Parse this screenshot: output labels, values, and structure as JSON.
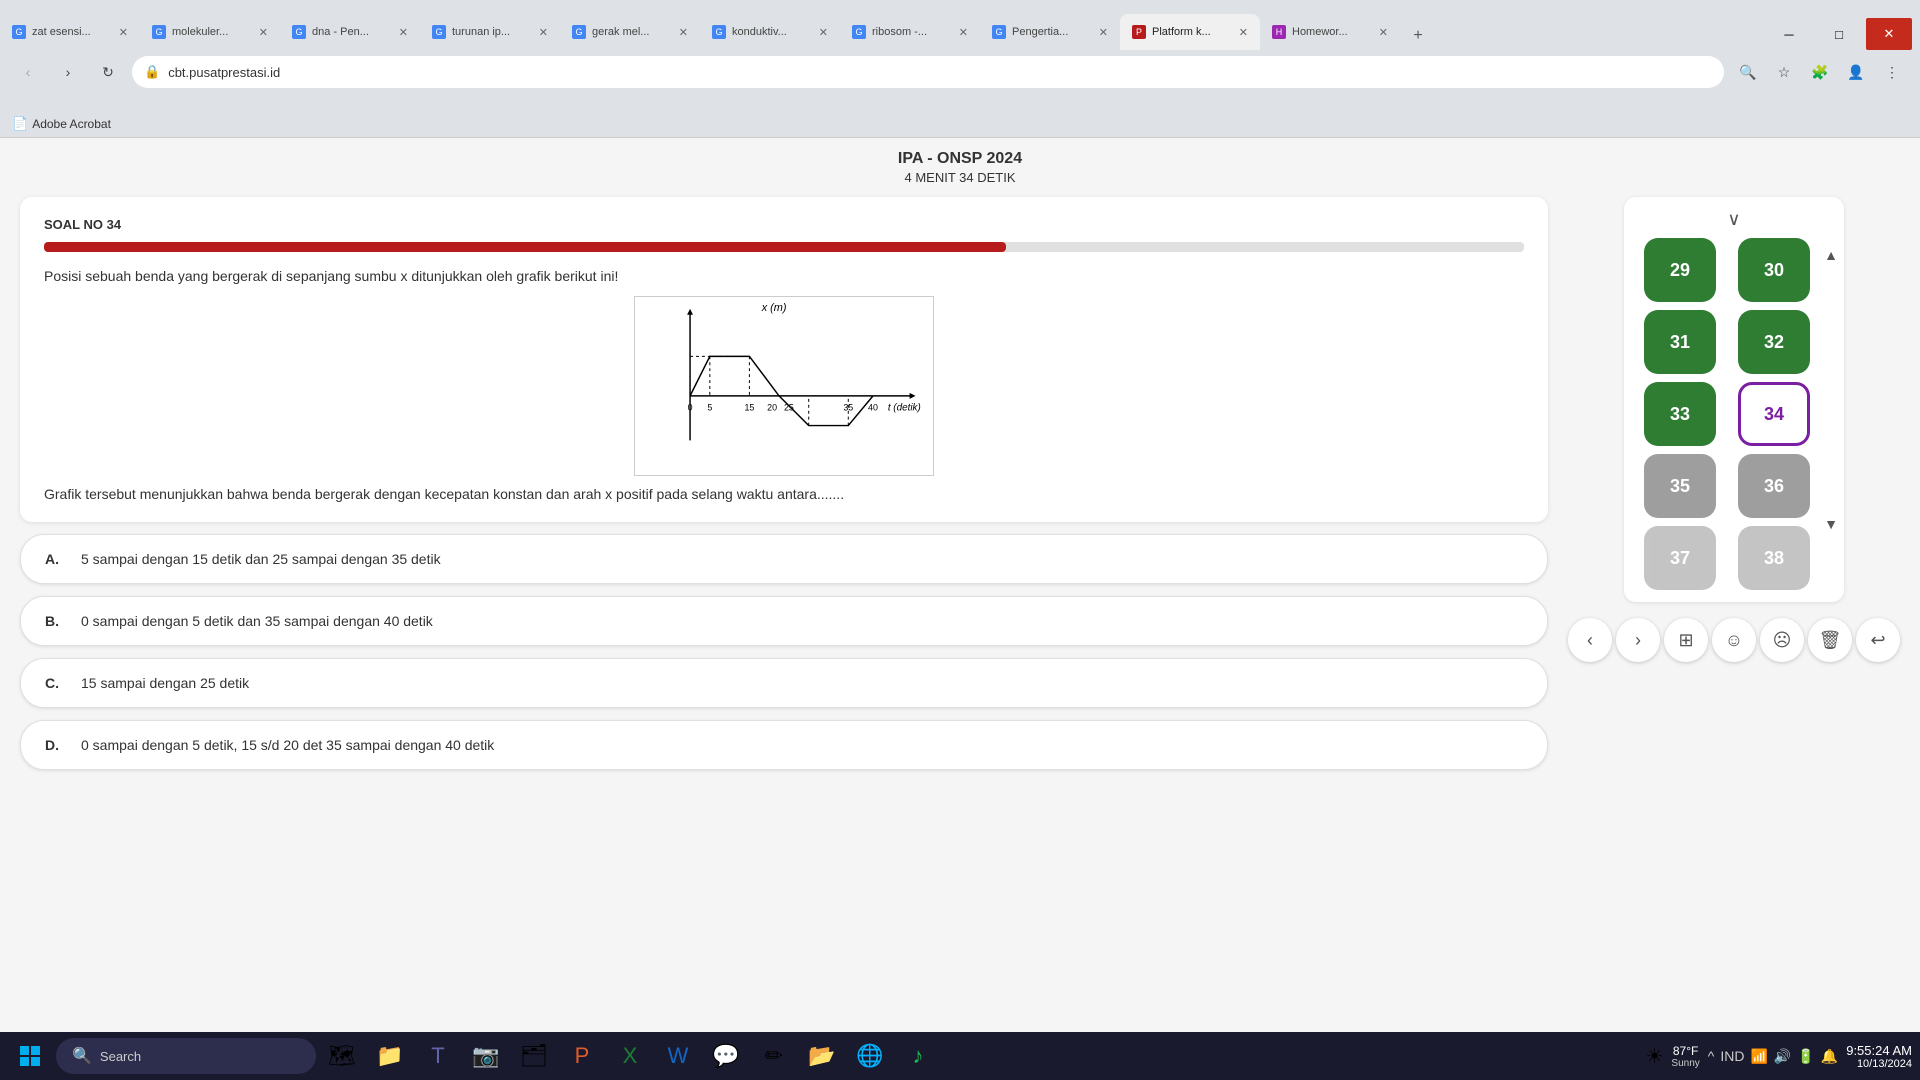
{
  "browser": {
    "tabs": [
      {
        "id": 1,
        "title": "zat esensi...",
        "favicon": "G",
        "active": false
      },
      {
        "id": 2,
        "title": "molekuler...",
        "favicon": "G",
        "active": false
      },
      {
        "id": 3,
        "title": "dna - Pen...",
        "favicon": "G",
        "active": false
      },
      {
        "id": 4,
        "title": "turunan ip...",
        "favicon": "G",
        "active": false
      },
      {
        "id": 5,
        "title": "gerak mel...",
        "favicon": "G",
        "active": false
      },
      {
        "id": 6,
        "title": "konduktiv...",
        "favicon": "G",
        "active": false
      },
      {
        "id": 7,
        "title": "ribosom -...",
        "favicon": "G",
        "active": false
      },
      {
        "id": 8,
        "title": "Pengertia...",
        "favicon": "G",
        "active": false
      },
      {
        "id": 9,
        "title": "Platform k...",
        "favicon": "P",
        "active": true
      },
      {
        "id": 10,
        "title": "Homewor...",
        "favicon": "H",
        "active": false
      }
    ],
    "url": "cbt.pusatprestasi.id",
    "bookmarks": [
      {
        "label": "Adobe Acrobat"
      }
    ]
  },
  "exam": {
    "title": "IPA - ONSP 2024",
    "timer": "4 MENIT 34 DETIK",
    "soal_label": "SOAL NO 34",
    "progress_percent": 65,
    "question_text": "Posisi sebuah benda yang bergerak di sepanjang sumbu x ditunjukkan oleh grafik berikut ini!",
    "graph_sub_text": "Grafik tersebut menunjukkan bahwa benda bergerak dengan kecepatan konstan dan arah x  positif  pada selang waktu antara.......",
    "options": [
      {
        "letter": "A.",
        "text": "5 sampai dengan 15 detik dan 25 sampai dengan 35 detik"
      },
      {
        "letter": "B.",
        "text": "0 sampai dengan 5 detik dan 35 sampai dengan 40 detik"
      },
      {
        "letter": "C.",
        "text": "15 sampai dengan 25 detik"
      },
      {
        "letter": "D.",
        "text": "0 sampai dengan 5 detik, 15 s/d 20 det 35 sampai dengan 40 detik"
      }
    ]
  },
  "nav_panel": {
    "chevron_label": "∨",
    "buttons": [
      {
        "num": "29",
        "state": "green"
      },
      {
        "num": "30",
        "state": "green"
      },
      {
        "num": "31",
        "state": "green"
      },
      {
        "num": "32",
        "state": "green"
      },
      {
        "num": "33",
        "state": "green"
      },
      {
        "num": "34",
        "state": "purple-outline"
      },
      {
        "num": "35",
        "state": "gray"
      },
      {
        "num": "36",
        "state": "gray"
      },
      {
        "num": "37",
        "state": "gray"
      },
      {
        "num": "38",
        "state": "gray"
      }
    ],
    "scroll_up": "▲",
    "scroll_down": "▼"
  },
  "bottom_controls": {
    "prev": "‹",
    "next": "›",
    "grid": "⊞",
    "smile": "☺",
    "sad": "☹",
    "trash": "🗑",
    "arrow": "↩"
  },
  "taskbar": {
    "search_placeholder": "Search",
    "weather_temp": "87°F",
    "weather_desc": "Sunny",
    "time": "9:55:24 AM",
    "date": "10/13/2024",
    "lang": "IND"
  }
}
